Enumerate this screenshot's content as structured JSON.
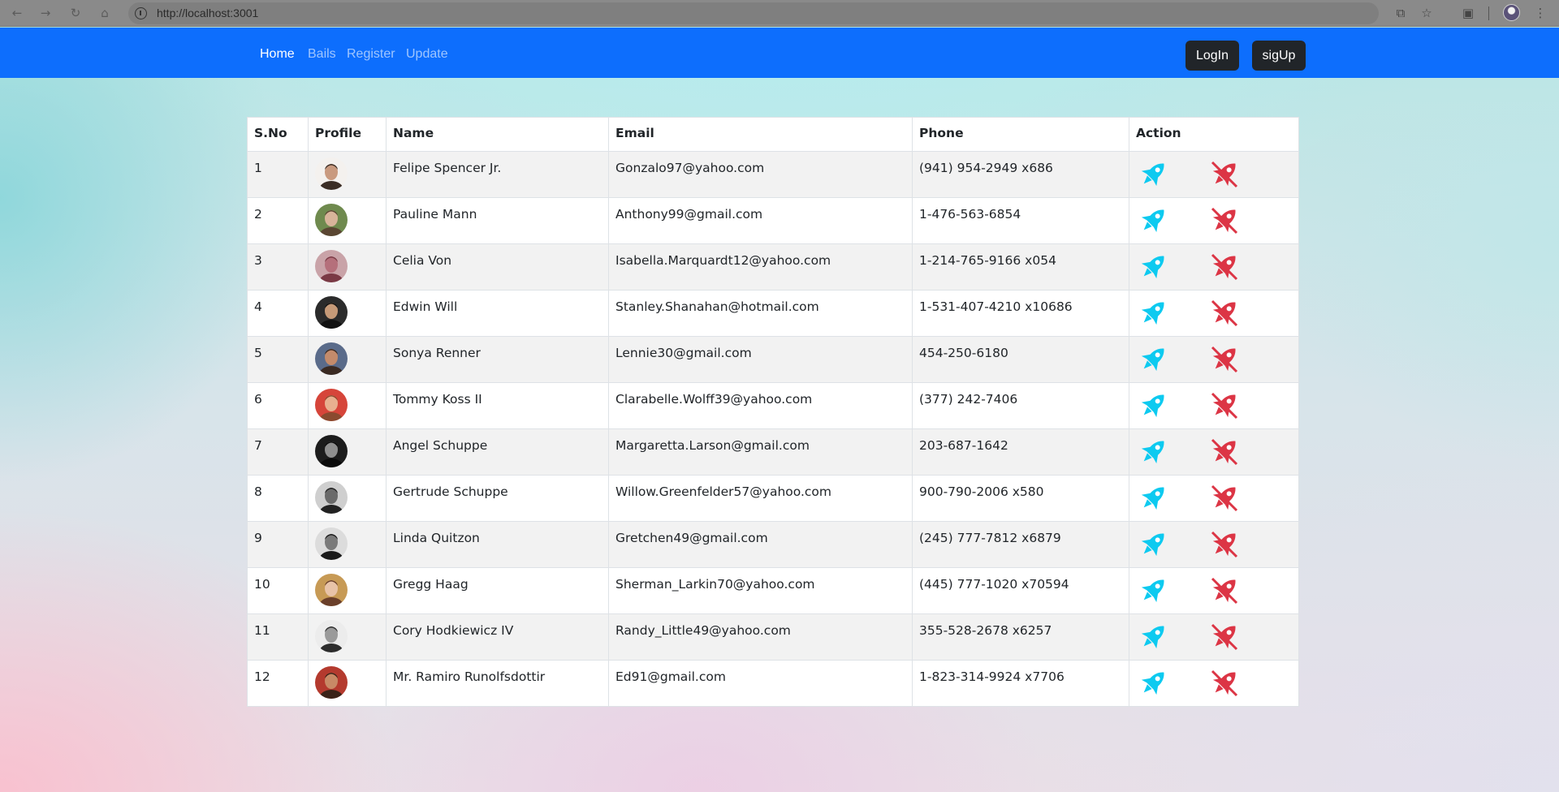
{
  "browser": {
    "url": "http://localhost:3001",
    "back_icon": "←",
    "forward_icon": "→",
    "reload_icon": "↻",
    "home_icon": "⌂",
    "install_icon": "⧉",
    "star_icon": "☆",
    "extensions_icon": "▣",
    "menu_icon": "⋮"
  },
  "navbar": {
    "links": [
      {
        "label": "Home",
        "active": true
      },
      {
        "label": "Bails",
        "active": false
      },
      {
        "label": "Register",
        "active": false
      },
      {
        "label": "Update",
        "active": false
      }
    ],
    "login_label": "LogIn",
    "signup_label": "sigUp",
    "accent_color": "#0d6efd",
    "button_color": "#212529"
  },
  "table": {
    "headers": [
      "S.No",
      "Profile",
      "Name",
      "Email",
      "Phone",
      "Action"
    ],
    "edit_icon": "rocket-icon",
    "edit_color": "#0dcaf0",
    "delete_icon": "rocket-crossed-icon",
    "delete_color": "#dc3545",
    "rows": [
      {
        "sno": "1",
        "name": "Felipe Spencer Jr.",
        "email": "Gonzalo97@yahoo.com",
        "phone": "(941) 954-2949 x686"
      },
      {
        "sno": "2",
        "name": "Pauline Mann",
        "email": "Anthony99@gmail.com",
        "phone": "1-476-563-6854"
      },
      {
        "sno": "3",
        "name": "Celia Von",
        "email": "Isabella.Marquardt12@yahoo.com",
        "phone": "1-214-765-9166 x054"
      },
      {
        "sno": "4",
        "name": "Edwin Will",
        "email": "Stanley.Shanahan@hotmail.com",
        "phone": "1-531-407-4210 x10686"
      },
      {
        "sno": "5",
        "name": "Sonya Renner",
        "email": "Lennie30@gmail.com",
        "phone": "454-250-6180"
      },
      {
        "sno": "6",
        "name": "Tommy Koss II",
        "email": "Clarabelle.Wolff39@yahoo.com",
        "phone": "(377) 242-7406"
      },
      {
        "sno": "7",
        "name": "Angel Schuppe",
        "email": "Margaretta.Larson@gmail.com",
        "phone": "203-687-1642"
      },
      {
        "sno": "8",
        "name": "Gertrude Schuppe",
        "email": "Willow.Greenfelder57@yahoo.com",
        "phone": "900-790-2006 x580"
      },
      {
        "sno": "9",
        "name": "Linda Quitzon",
        "email": "Gretchen49@gmail.com",
        "phone": "(245) 777-7812 x6879"
      },
      {
        "sno": "10",
        "name": "Gregg Haag",
        "email": "Sherman_Larkin70@yahoo.com",
        "phone": "(445) 777-1020 x70594"
      },
      {
        "sno": "11",
        "name": "Cory Hodkiewicz IV",
        "email": "Randy_Little49@yahoo.com",
        "phone": "355-528-2678 x6257"
      },
      {
        "sno": "12",
        "name": "Mr. Ramiro Runolfsdottir",
        "email": "Ed91@gmail.com",
        "phone": "1-823-314-9924 x7706"
      }
    ]
  }
}
